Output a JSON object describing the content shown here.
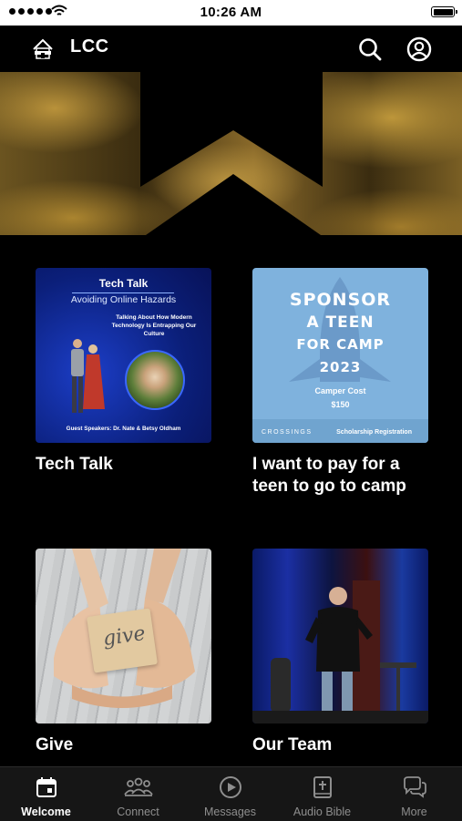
{
  "status_bar": {
    "time": "10:26 AM"
  },
  "header": {
    "title": "LCC",
    "search_icon": "search-icon",
    "profile_icon": "profile-icon"
  },
  "banner": {
    "icon": "chevron-up-logo"
  },
  "cards": [
    {
      "title": "Tech Talk",
      "image": {
        "heading": "Tech Talk",
        "subheading": "Avoiding Online Hazards",
        "description": "Talking About How Modern Technology Is Entrapping Our Culture",
        "footer": "Guest Speakers: Dr. Nate & Betsy Oldham"
      }
    },
    {
      "title": "I want to pay for a teen to go to camp",
      "image": {
        "line1": "SPONSOR",
        "line2": "A TEEN",
        "line3": "FOR CAMP",
        "line4": "2023",
        "cost_label": "Camper Cost",
        "cost_value": "$150",
        "brand": "CROSSINGS",
        "registration": "Scholarship Registration"
      }
    },
    {
      "title": "Give",
      "image": {
        "note_text": "give"
      }
    },
    {
      "title": "Our Team",
      "image": {}
    }
  ],
  "bottom_nav": [
    {
      "label": "Welcome",
      "icon": "calendar-icon",
      "active": true
    },
    {
      "label": "Connect",
      "icon": "people-icon",
      "active": false
    },
    {
      "label": "Messages",
      "icon": "play-icon",
      "active": false
    },
    {
      "label": "Audio Bible",
      "icon": "bible-icon",
      "active": false
    },
    {
      "label": "More",
      "icon": "chat-icon",
      "active": false
    }
  ]
}
